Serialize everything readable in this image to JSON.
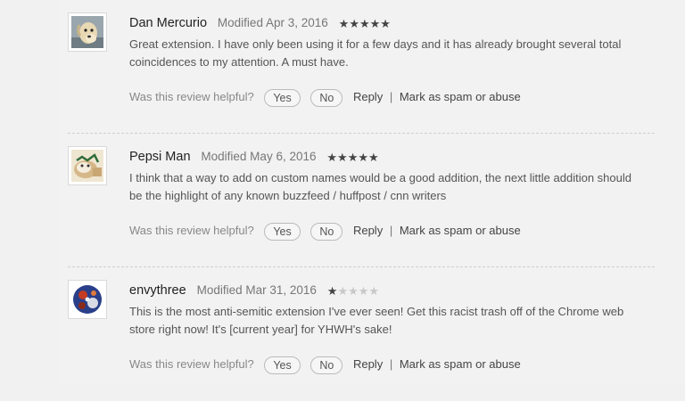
{
  "reviews": [
    {
      "author": "Dan Mercurio",
      "date": "Modified Apr 3, 2016",
      "rating": 5,
      "avatar_icon": "dog-photo-icon",
      "text": "Great extension. I have only been using it for a few days and it has already brought several total coincidences to my attention. A must have.",
      "helpful_prompt": "Was this review helpful?",
      "yes_label": "Yes",
      "no_label": "No",
      "reply_label": "Reply",
      "spam_label": "Mark as spam or abuse"
    },
    {
      "author": "Pepsi Man",
      "date": "Modified May 6, 2016",
      "rating": 5,
      "avatar_icon": "cat-photo-icon",
      "text": "I think that a way to add on custom names would be a good addition, the next little addition should be the highlight of any known buzzfeed / huffpost / cnn writers",
      "helpful_prompt": "Was this review helpful?",
      "yes_label": "Yes",
      "no_label": "No",
      "reply_label": "Reply",
      "spam_label": "Mark as spam or abuse"
    },
    {
      "author": "envythree",
      "date": "Modified Mar 31, 2016",
      "rating": 1,
      "avatar_icon": "abstract-photo-icon",
      "text": "This is the most anti-semitic extension I've ever seen! Get this racist trash off of the Chrome web store right now! It's [current year] for YHWH's sake!",
      "helpful_prompt": "Was this review helpful?",
      "yes_label": "Yes",
      "no_label": "No",
      "reply_label": "Reply",
      "spam_label": "Mark as spam or abuse"
    }
  ],
  "star_char": "★",
  "separator": "|"
}
